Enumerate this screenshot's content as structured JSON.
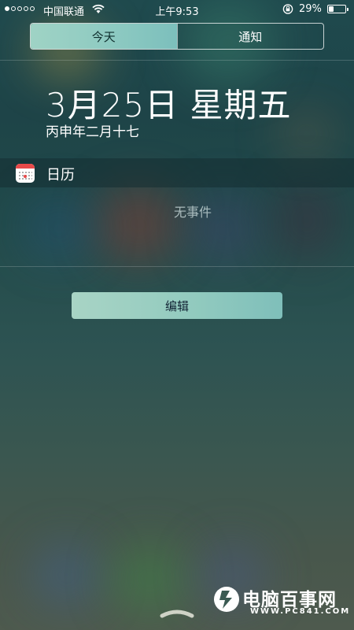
{
  "status_bar": {
    "carrier": "中国联通",
    "time": "上午9:53",
    "battery": "29%",
    "battery_level": 0.29,
    "signal_bars_filled": 1,
    "signal_bars_total": 5
  },
  "tabs": [
    {
      "label": "今天",
      "active": true
    },
    {
      "label": "通知",
      "active": false
    }
  ],
  "today": {
    "date": "3月25日 星期五",
    "lunar": "丙申年二月十七"
  },
  "calendar_widget": {
    "title": "日历",
    "empty_text": "无事件",
    "icon": "calendar-icon"
  },
  "edit_button": "编辑",
  "watermark": {
    "name": "电脑百事网",
    "url": "WWW.PC841.COM"
  },
  "colors": {
    "accent": "#8cc9c1",
    "calendar_red": "#e84a4a"
  }
}
